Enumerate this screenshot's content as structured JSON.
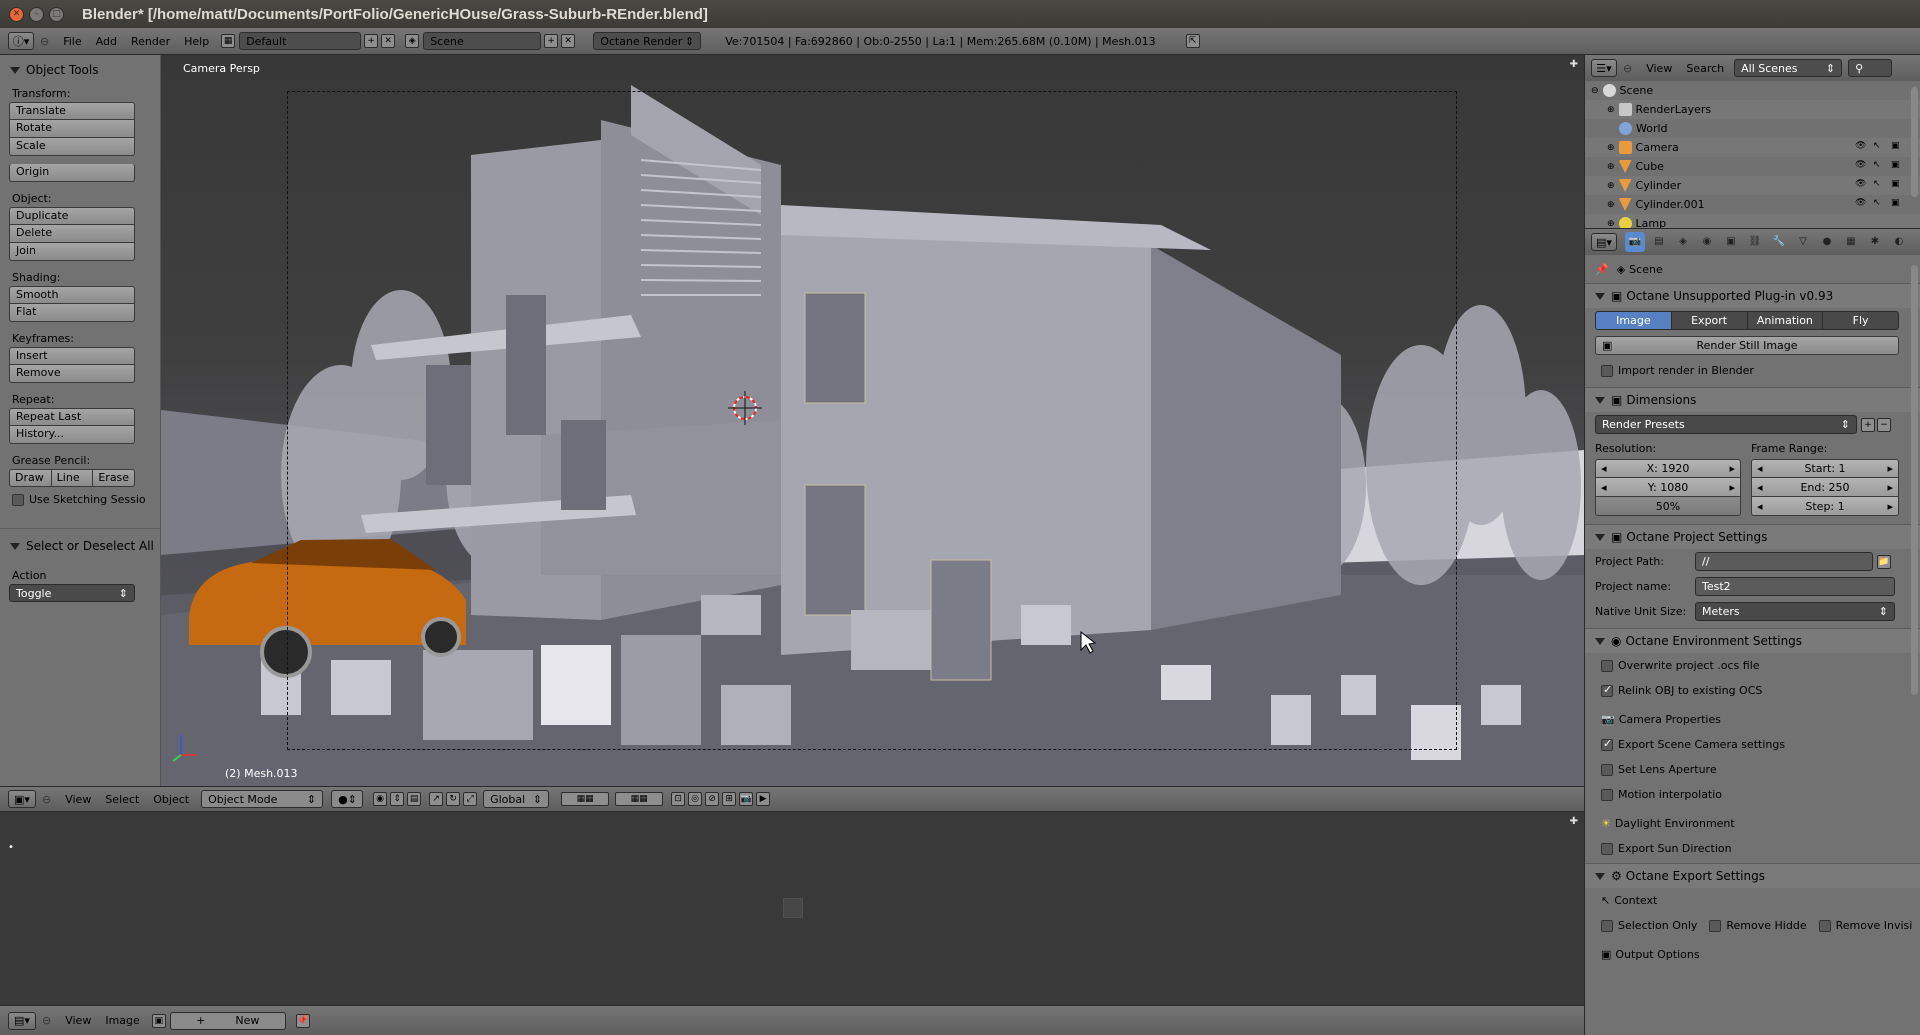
{
  "title_bar": {
    "title": "Blender* [/home/matt/Documents/PortFolio/GenericHOuse/Grass-Suburb-REnder.blend]"
  },
  "info_header": {
    "menus": [
      "File",
      "Add",
      "Render",
      "Help"
    ],
    "screen_layout": "Default",
    "scene": "Scene",
    "render_engine": "Octane Render",
    "stats": "Ve:701504 | Fa:692860 | Ob:0-2550 | La:1 | Mem:265.68M (0.10M) | Mesh.013"
  },
  "tool_shelf": {
    "title": "Object Tools",
    "transform_label": "Transform:",
    "transform_buttons": [
      "Translate",
      "Rotate",
      "Scale"
    ],
    "origin_button": "Origin",
    "object_label": "Object:",
    "object_buttons": [
      "Duplicate",
      "Delete",
      "Join"
    ],
    "shading_label": "Shading:",
    "shading_buttons": [
      "Smooth",
      "Flat"
    ],
    "keyframes_label": "Keyframes:",
    "keyframe_buttons": [
      "Insert",
      "Remove"
    ],
    "repeat_label": "Repeat:",
    "repeat_buttons": [
      "Repeat Last",
      "History..."
    ],
    "grease_label": "Grease Pencil:",
    "grease_buttons": [
      "Draw",
      "Line",
      "Erase"
    ],
    "sketching_label": "Use Sketching Sessio",
    "operator_title": "Select or Deselect All",
    "action_label": "Action",
    "action_value": "Toggle"
  },
  "viewport": {
    "view_label": "Camera Persp",
    "active_object": "(2) Mesh.013"
  },
  "viewport_header": {
    "menus": [
      "View",
      "Select",
      "Object"
    ],
    "mode": "Object Mode",
    "orientation": "Global"
  },
  "image_editor_header": {
    "menus": [
      "View",
      "Image"
    ],
    "new_button": "New"
  },
  "outliner": {
    "menus": [
      "View",
      "Search"
    ],
    "filter": "All Scenes",
    "items": [
      {
        "name": "Scene",
        "color": "#e8e8e8"
      },
      {
        "name": "RenderLayers",
        "color": "#d0d0d0"
      },
      {
        "name": "World",
        "color": "#7fa5d8"
      },
      {
        "name": "Camera",
        "color": "#e89a3c"
      },
      {
        "name": "Cube",
        "color": "#e89a3c"
      },
      {
        "name": "Cylinder",
        "color": "#e89a3c"
      },
      {
        "name": "Cylinder.001",
        "color": "#e89a3c"
      },
      {
        "name": "Lamp",
        "color": "#e8d23c"
      }
    ]
  },
  "properties": {
    "context": "Scene",
    "plugin_panel": "Octane Unsupported Plug-in v0.93",
    "mode_tabs": [
      "Image",
      "Export",
      "Animation",
      "Fly"
    ],
    "active_tab": "Image",
    "render_button": "Render Still Image",
    "import_render": "Import render in Blender",
    "dimensions_panel": "Dimensions",
    "render_presets": "Render Presets",
    "resolution_label": "Resolution:",
    "res_x": "X: 1920",
    "res_y": "Y: 1080",
    "res_pct": "50%",
    "frame_range_label": "Frame Range:",
    "start": "Start: 1",
    "end": "End: 250",
    "step": "Step: 1",
    "project_panel": "Octane Project Settings",
    "project_path_label": "Project Path:",
    "project_path": "//",
    "project_name_label": "Project name:",
    "project_name": "Test2",
    "unit_size_label": "Native Unit Size:",
    "unit_size": "Meters",
    "env_panel": "Octane Environment Settings",
    "overwrite": "Overwrite project .ocs file",
    "relink": "Relink OBJ to existing OCS",
    "camera_props": "Camera Properties",
    "export_camera": "Export Scene Camera settings",
    "set_lens": "Set Lens Aperture",
    "motion": "Motion interpolatio",
    "daylight": "Daylight Environment",
    "export_sun": "Export Sun Direction",
    "export_panel": "Octane Export Settings",
    "context_label": "Context",
    "selection_only": "Selection Only",
    "remove_hidden": "Remove Hidde",
    "remove_invis": "Remove Invisi",
    "output_options": "Output Options"
  },
  "colors": {
    "header": "#6e6e6e",
    "panel": "#727272",
    "accent_blue": "#5680c2",
    "car_orange": "#c66a12"
  }
}
